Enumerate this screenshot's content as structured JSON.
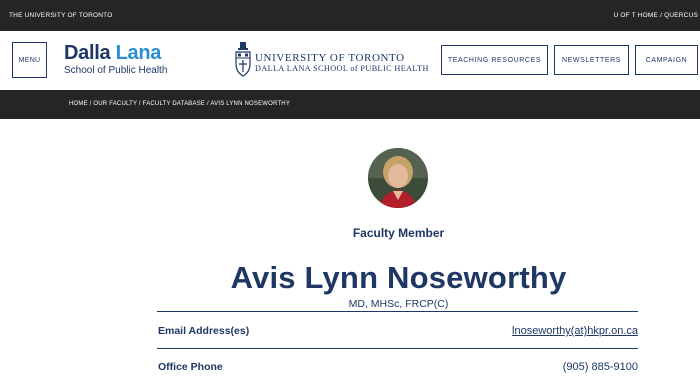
{
  "topbar": {
    "left": "THE UNIVERSITY OF TORONTO",
    "right": "U OF T HOME / QUERCUS"
  },
  "header": {
    "menu_label": "MENU",
    "logo": {
      "line1a": "Dalla",
      "line1b": "Lana",
      "line2": "School of Public Health"
    },
    "uoft": {
      "line1": "UNIVERSITY OF TORONTO",
      "line2": "DALLA LANA SCHOOL of PUBLIC HEALTH"
    },
    "nav": [
      "TEACHING RESOURCES",
      "NEWSLETTERS",
      "CAMPAIGN"
    ]
  },
  "breadcrumb": "HOME / OUR FACULTY / FACULTY DATABASE / AVIS LYNN NOSEWORTHY",
  "profile": {
    "role": "Faculty Member",
    "name": "Avis Lynn Noseworthy",
    "credentials": "MD, MHSc, FRCP(C)"
  },
  "details": {
    "email_label": "Email Address(es)",
    "email_value": "lnoseworthy(at)hkpr.on.ca",
    "phone_label": "Office Phone",
    "phone_value": "(905) 885-9100"
  },
  "colors": {
    "navy": "#1e3765",
    "accent_blue": "#2a8fd0",
    "bar": "#252525"
  }
}
